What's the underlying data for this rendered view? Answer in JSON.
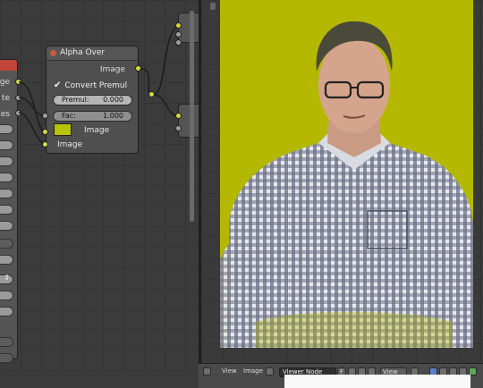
{
  "left_node": {
    "labels": [
      "ge",
      "te",
      "es"
    ]
  },
  "alpha_over": {
    "title": "Alpha Over",
    "output_label": "Image",
    "convert_premul_label": "Convert Premul",
    "convert_premul_checked": "✔",
    "premul_label": "Premul:",
    "premul_value": "0.000",
    "fac_label": "Fac:",
    "fac_value": "1.000",
    "input_image_1": "Image",
    "input_image_2": "Image",
    "swatch_color": "#b8c400"
  },
  "viewer": {
    "background_color": "#b5b800"
  },
  "toolbar": {
    "view_label": "View",
    "image_label": "Image",
    "image_name": "Viewer Node",
    "f_label": "F",
    "view_select": "View"
  }
}
